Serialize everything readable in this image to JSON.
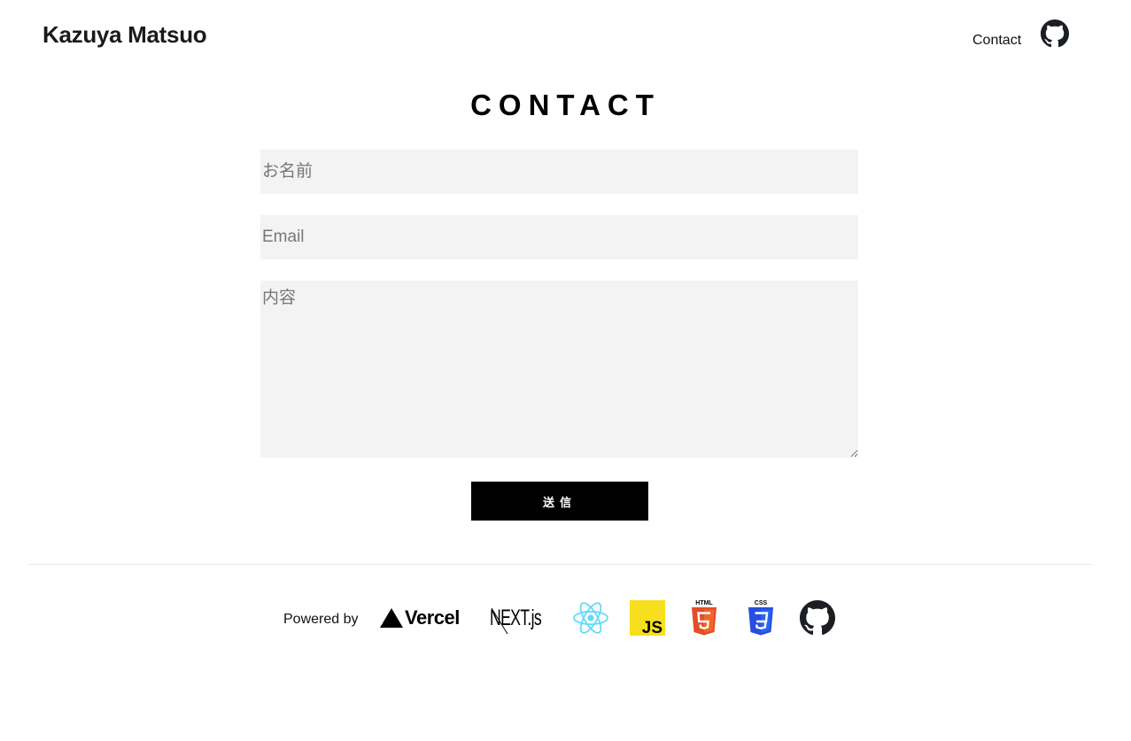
{
  "header": {
    "site_title": "Kazuya Matsuo",
    "nav": {
      "contact_label": "Contact",
      "github_icon": "github-icon"
    }
  },
  "main": {
    "heading": "CONTACT",
    "form": {
      "name_placeholder": "お名前",
      "name_value": "",
      "email_placeholder": "Email",
      "email_value": "",
      "message_placeholder": "内容",
      "message_value": "",
      "submit_label": "送信"
    }
  },
  "footer": {
    "powered_by_label": "Powered by",
    "logos": [
      {
        "name": "vercel-logo",
        "text": "Vercel"
      },
      {
        "name": "nextjs-logo",
        "text": "NEXT.js"
      },
      {
        "name": "react-logo"
      },
      {
        "name": "javascript-logo",
        "text": "JS"
      },
      {
        "name": "html5-logo",
        "text": "HTML"
      },
      {
        "name": "css3-logo",
        "text": "CSS"
      },
      {
        "name": "github-logo"
      }
    ]
  },
  "colors": {
    "input_background": "#f3f3f3",
    "button_background": "#000000",
    "react_cyan": "#61dafb",
    "js_yellow": "#f7df1e",
    "html_orange": "#e44d26",
    "css_blue": "#264de4"
  }
}
